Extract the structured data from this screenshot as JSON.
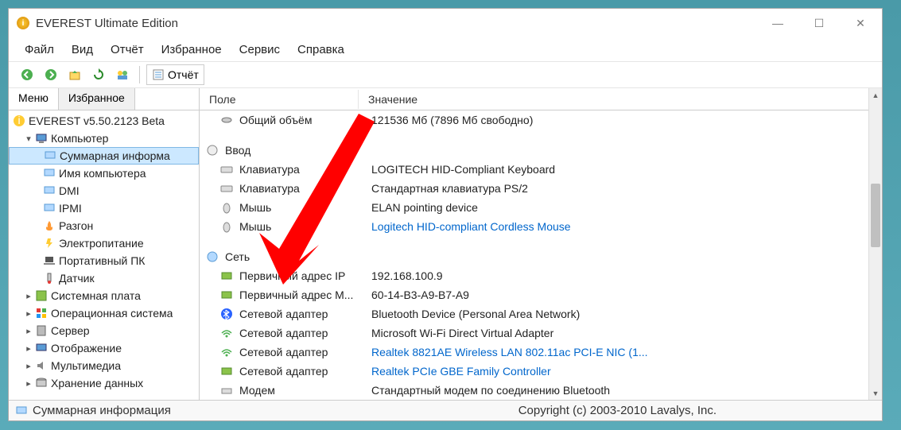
{
  "window": {
    "title": "EVEREST Ultimate Edition"
  },
  "menubar": [
    "Файл",
    "Вид",
    "Отчёт",
    "Избранное",
    "Сервис",
    "Справка"
  ],
  "toolbar": {
    "report_label": "Отчёт"
  },
  "sidebar": {
    "tabs": [
      "Меню",
      "Избранное"
    ],
    "root": "EVEREST v5.50.2123 Beta",
    "computer": {
      "label": "Компьютер",
      "children": [
        "Суммарная информа",
        "Имя компьютера",
        "DMI",
        "IPMI",
        "Разгон",
        "Электропитание",
        "Портативный ПК",
        "Датчик"
      ]
    },
    "others": [
      "Системная плата",
      "Операционная система",
      "Сервер",
      "Отображение",
      "Мультимедиа",
      "Хранение данных"
    ]
  },
  "list": {
    "header": {
      "col1": "Поле",
      "col2": "Значение"
    },
    "rows": [
      {
        "type": "child",
        "icon": "disk",
        "field": "Общий объём",
        "value": "121536 Мб (7896 Мб свободно)"
      },
      {
        "type": "spacer"
      },
      {
        "type": "group",
        "icon": "input",
        "field": "Ввод",
        "value": ""
      },
      {
        "type": "child",
        "icon": "keyboard",
        "field": "Клавиатура",
        "value": "LOGITECH HID-Compliant Keyboard"
      },
      {
        "type": "child",
        "icon": "keyboard",
        "field": "Клавиатура",
        "value": "Стандартная клавиатура PS/2"
      },
      {
        "type": "child",
        "icon": "mouse",
        "field": "Мышь",
        "value": "ELAN pointing device"
      },
      {
        "type": "child",
        "icon": "mouse",
        "field": "Мышь",
        "value": "Logitech HID-compliant Cordless Mouse",
        "link": true
      },
      {
        "type": "spacer"
      },
      {
        "type": "group",
        "icon": "network",
        "field": "Сеть",
        "value": ""
      },
      {
        "type": "child",
        "icon": "nic",
        "field": "Первичный адрес IP",
        "value": "192.168.100.9"
      },
      {
        "type": "child",
        "icon": "nic",
        "field": "Первичный адрес М...",
        "value": "60-14-B3-A9-B7-A9"
      },
      {
        "type": "child",
        "icon": "bluetooth",
        "field": "Сетевой адаптер",
        "value": "Bluetooth Device (Personal Area Network)"
      },
      {
        "type": "child",
        "icon": "wifi",
        "field": "Сетевой адаптер",
        "value": "Microsoft Wi-Fi Direct Virtual Adapter"
      },
      {
        "type": "child",
        "icon": "wifi",
        "field": "Сетевой адаптер",
        "value": "Realtek 8821AE Wireless LAN 802.11ac PCI-E NIC  (1...",
        "link": true
      },
      {
        "type": "child",
        "icon": "nic",
        "field": "Сетевой адаптер",
        "value": "Realtek PCIe GBE Family Controller",
        "link": true
      },
      {
        "type": "child",
        "icon": "modem",
        "field": "Модем",
        "value": "Стандартный модем по соединению Bluetooth"
      }
    ]
  },
  "statusbar": {
    "text": "Суммарная информация",
    "copyright": "Copyright (c) 2003-2010 Lavalys, Inc."
  }
}
